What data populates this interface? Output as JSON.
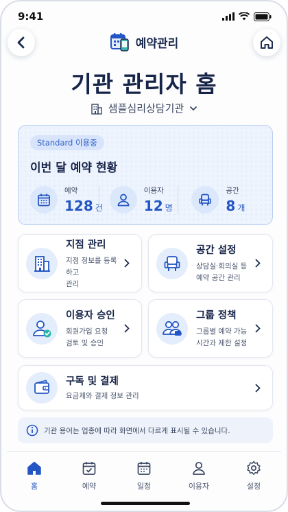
{
  "status_bar": {
    "time": "9:41"
  },
  "header": {
    "brand": "예약관리"
  },
  "page_title": "기관 관리자 홈",
  "organization": {
    "name": "샘플심리상담기관"
  },
  "summary": {
    "badge": "Standard 이용중",
    "title": "이번 달 예약 현황",
    "stats": [
      {
        "label": "예약",
        "value": "128",
        "unit": "건",
        "icon": "calendar-icon"
      },
      {
        "label": "이용자",
        "value": "12",
        "unit": "명",
        "icon": "user-icon"
      },
      {
        "label": "공간",
        "value": "8",
        "unit": "개",
        "icon": "chair-icon"
      }
    ]
  },
  "menu": {
    "branch": {
      "title": "지점 관리",
      "desc1": "지점 정보를 등록하고",
      "desc2": "관리"
    },
    "space": {
      "title": "공간 설정",
      "desc1": "상담실·회의실 등",
      "desc2": "예약 공간 관리"
    },
    "approval": {
      "title": "이용자 승인",
      "desc1": "회원가입 요청",
      "desc2": "검토 및 승인"
    },
    "group": {
      "title": "그룹 정책",
      "desc1": "그룹별 예약 가능",
      "desc2": "시간과 제한 설정"
    },
    "billing": {
      "title": "구독 및 결제",
      "desc1": "요금제와 결제 정보 관리"
    }
  },
  "notice": "기관 용어는 업종에 따라 화면에서 다르게 표시될 수 있습니다.",
  "nav": [
    {
      "label": "홈",
      "icon": "home-icon",
      "active": true
    },
    {
      "label": "예약",
      "icon": "calendar-check-icon"
    },
    {
      "label": "일정",
      "icon": "calendar-icon"
    },
    {
      "label": "이용자",
      "icon": "user-icon"
    },
    {
      "label": "설정",
      "icon": "gear-icon"
    }
  ],
  "colors": {
    "primary": "#2356c4",
    "navy": "#172449",
    "card_bg": "#eef4fd"
  }
}
